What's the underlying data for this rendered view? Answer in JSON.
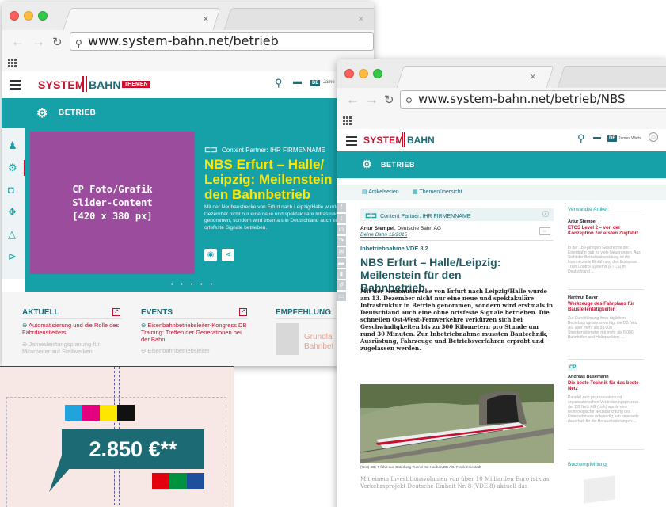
{
  "window1": {
    "tab_close": "×",
    "url": "www.system-bahn.net/betrieb",
    "logo_system": "SYSTEM",
    "logo_bahn": "BAHN",
    "themen": "THEMEN",
    "de": "DE",
    "user_short": "Jame",
    "section": "BETRIEB",
    "slider_placeholder": "CP Foto/Grafik\nSlider-Content\n[420 x 380 px]",
    "cp_label": "Content Partner:",
    "cp_name": "IHR FIRMENNAME",
    "slide_title": "NBS Erfurt – Halle/ Leipzig: Meilenstein für den Bahnbetrieb",
    "slide_text": "Mit der Neubaustrecke von Erfurt nach Leipzig/Halle wurde am 13. Dezember nicht nur eine neue und spektakuläre Infrastruktur in Betrieb genommen, sondern wird erstmals in Deutschland auch eine ohne ortsfeste Signale betrieben.",
    "dots": "• • • • •",
    "aktuell_head": "AKTUELL",
    "events_head": "EVENTS",
    "empfehlung_head": "EMPFEHLUNG",
    "aktuell_items": [
      "Automatisierung und die Rolle des Fahrdienstleiters",
      "Jahresleistungsplanung für Mitarbeiter auf Stellwerken"
    ],
    "events_items": [
      "Eisenbahnbetriebsleiter-Kongress DB Training: Treffen der Generationen bei der Bahn",
      "Eisenbahnbetriebsleiter"
    ],
    "empfehlung_item": "Grundla Bahnbet"
  },
  "window2": {
    "tab_close": "×",
    "url": "www.system-bahn.net/betrieb/NBS",
    "logo_system": "SYSTEM",
    "logo_bahn": "BAHN",
    "de": "DE",
    "user_name": "James Watts",
    "section": "BETRIEB",
    "nav_artikelserien": "Artikelserien",
    "nav_themen": "Themenübersicht",
    "cp_label": "Content Partner: IHR FIRMENNAME",
    "author_name": "Artur Stempel",
    "author_org": ", Deutsche Bahn AG",
    "author_source": "Deine Bahn 12/2015",
    "kicker": "Inbetriebnahme VDE 8.2",
    "title": "NBS Erfurt – Halle/Leipzig: Meilenstein für den Bahnbetrieb",
    "body": "Mit der Neubaustrecke von Erfurt nach Leipzig/Halle wurde am 13. Dezember nicht nur eine neue und spektakuläre Infrastruktur in Betrieb genommen, sondern wird erstmals in Deutschland auch eine ohne ortsfeste Signale betrieben. Die schnellen Ost-West-Fernverkehre verkürzen sich bei Geschwindigkeiten bis zu 300 Kilometern pro Stunde um rund 30 Minuten. Zur Inbetriebnahme mussten Bautechnik, Ausrüstung, Fahrzeuge und Betriebsverfahren erprobt und zugelassen werden.",
    "image_caption": "(Test) ICE-T fährt aus Osterberg-Tunnel mit Hauben/DB AG, Frank Kniestedt",
    "body2": "Mit einem Investitionsvolumen von über 10 Milliarden Euro ist das Verkehrsprojekt Deutsche Einheit Nr. 8 (VDE 8) aktuell das",
    "side_heading": "Verwandte Artikel:",
    "side_articles": [
      {
        "author": "Artur Stempel",
        "title": "ETCS Level 2 – von der Konzeption zur ersten Zugfahrt",
        "text": "In der 180-jährigen Geschichte der Eisenbahn gab es viele Neuerungen. Aus Sicht der Betriebsabwicklung ist die kommerzielle Einführung des European Train Control Systems (ETCS) in Deutschland ..."
      },
      {
        "author": "Hartmut Bayer",
        "title": "Werkzeuge des Fahrplans für Baustellentätigkeiten",
        "text": "Zur Durchführung ihres täglichen Betriebsprogramms verfügt die DB Netz AG über mehr als 33.000 Streckenkilometer mit mehr als 6.000 Bahnhöfen und Haltepunkten. ..."
      },
      {
        "author": "Andreas Busemann",
        "title": "Die beste Technik für das beste Netz",
        "text": "Parallel zum prozessualen und organisatorischen Veränderungsprozess der DB Netz AG (Link) wurde eine technologische Neuausrichtung des Unternehmens notwendig, um einerseits dauerhaft für die Herausforderungen ..."
      }
    ],
    "cp_mini": "CP",
    "buch_heading": "Buchempfehlung:"
  },
  "ad": {
    "price": "2.850 €**"
  },
  "colors": {
    "teal": "#16a1a8",
    "dark_teal": "#1e6a76",
    "red": "#c8102e",
    "purple": "#9b4c9d",
    "yellow": "#ffe600"
  }
}
